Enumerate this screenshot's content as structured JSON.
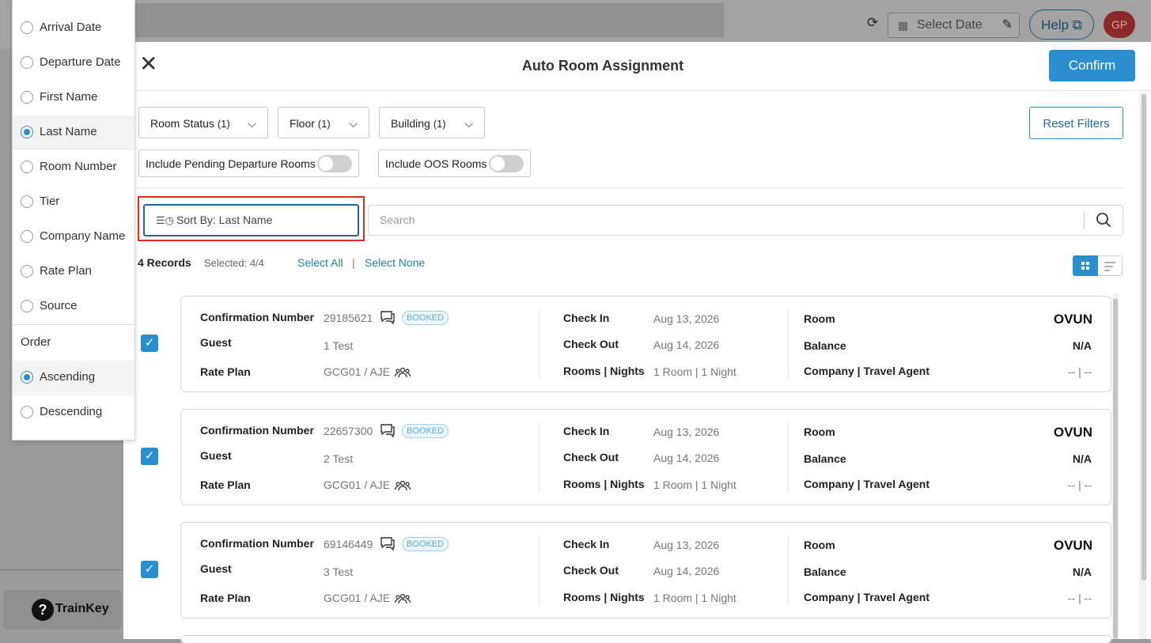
{
  "topbar": {
    "date_placeholder": "Select Date",
    "help_label": "Help",
    "avatar_initials": "GP"
  },
  "bottombar": {
    "trainkey_label": "TrainKey"
  },
  "modal": {
    "title": "Auto Room Assignment",
    "confirm_label": "Confirm",
    "filters": {
      "room_status": "Room Status",
      "room_status_count": "(1)",
      "floor": "Floor",
      "floor_count": "(1)",
      "building": "Building",
      "building_count": "(1)",
      "reset_label": "Reset Filters",
      "include_pending": "Include Pending Departure Rooms",
      "include_oos": "Include OOS Rooms"
    },
    "sort_label": "Sort By: Last Name",
    "search_placeholder": "Search",
    "records_label": "4 Records",
    "selected_label": "Selected: 4/4",
    "select_all": "Select All",
    "pipe": "|",
    "select_none": "Select None",
    "labels": {
      "confirmation": "Confirmation Number",
      "guest": "Guest",
      "rate_plan": "Rate Plan",
      "check_in": "Check In",
      "check_out": "Check Out",
      "rooms_nights": "Rooms | Nights",
      "room": "Room",
      "balance": "Balance",
      "company": "Company | Travel Agent"
    },
    "cards": [
      {
        "confirmation": "29185621",
        "status": "BOOKED",
        "guest": "1 Test",
        "rate_plan": "GCG01 / AJE",
        "check_in": "Aug 13, 2026",
        "check_out": "Aug 14, 2026",
        "rooms_nights": "1 Room | 1 Night",
        "room": "OVUN",
        "balance": "N/A",
        "company": "-- | --"
      },
      {
        "confirmation": "22657300",
        "status": "BOOKED",
        "guest": "2 Test",
        "rate_plan": "GCG01 / AJE",
        "check_in": "Aug 13, 2026",
        "check_out": "Aug 14, 2026",
        "rooms_nights": "1 Room | 1 Night",
        "room": "OVUN",
        "balance": "N/A",
        "company": "-- | --"
      },
      {
        "confirmation": "69146449",
        "status": "BOOKED",
        "guest": "3 Test",
        "rate_plan": "GCG01 / AJE",
        "check_in": "Aug 13, 2026",
        "check_out": "Aug 14, 2026",
        "rooms_nights": "1 Room | 1 Night",
        "room": "OVUN",
        "balance": "N/A",
        "company": "-- | --"
      }
    ]
  },
  "sort_menu": {
    "options": [
      "Arrival Date",
      "Departure Date",
      "First Name",
      "Last Name",
      "Room Number",
      "Tier",
      "Company Name",
      "Rate Plan",
      "Source"
    ],
    "selected_option": "Last Name",
    "order_heading": "Order",
    "order_options": [
      "Ascending",
      "Descending"
    ],
    "selected_order": "Ascending"
  },
  "colors": {
    "accent": "#2b8fcf",
    "highlight": "#e62b1e"
  }
}
